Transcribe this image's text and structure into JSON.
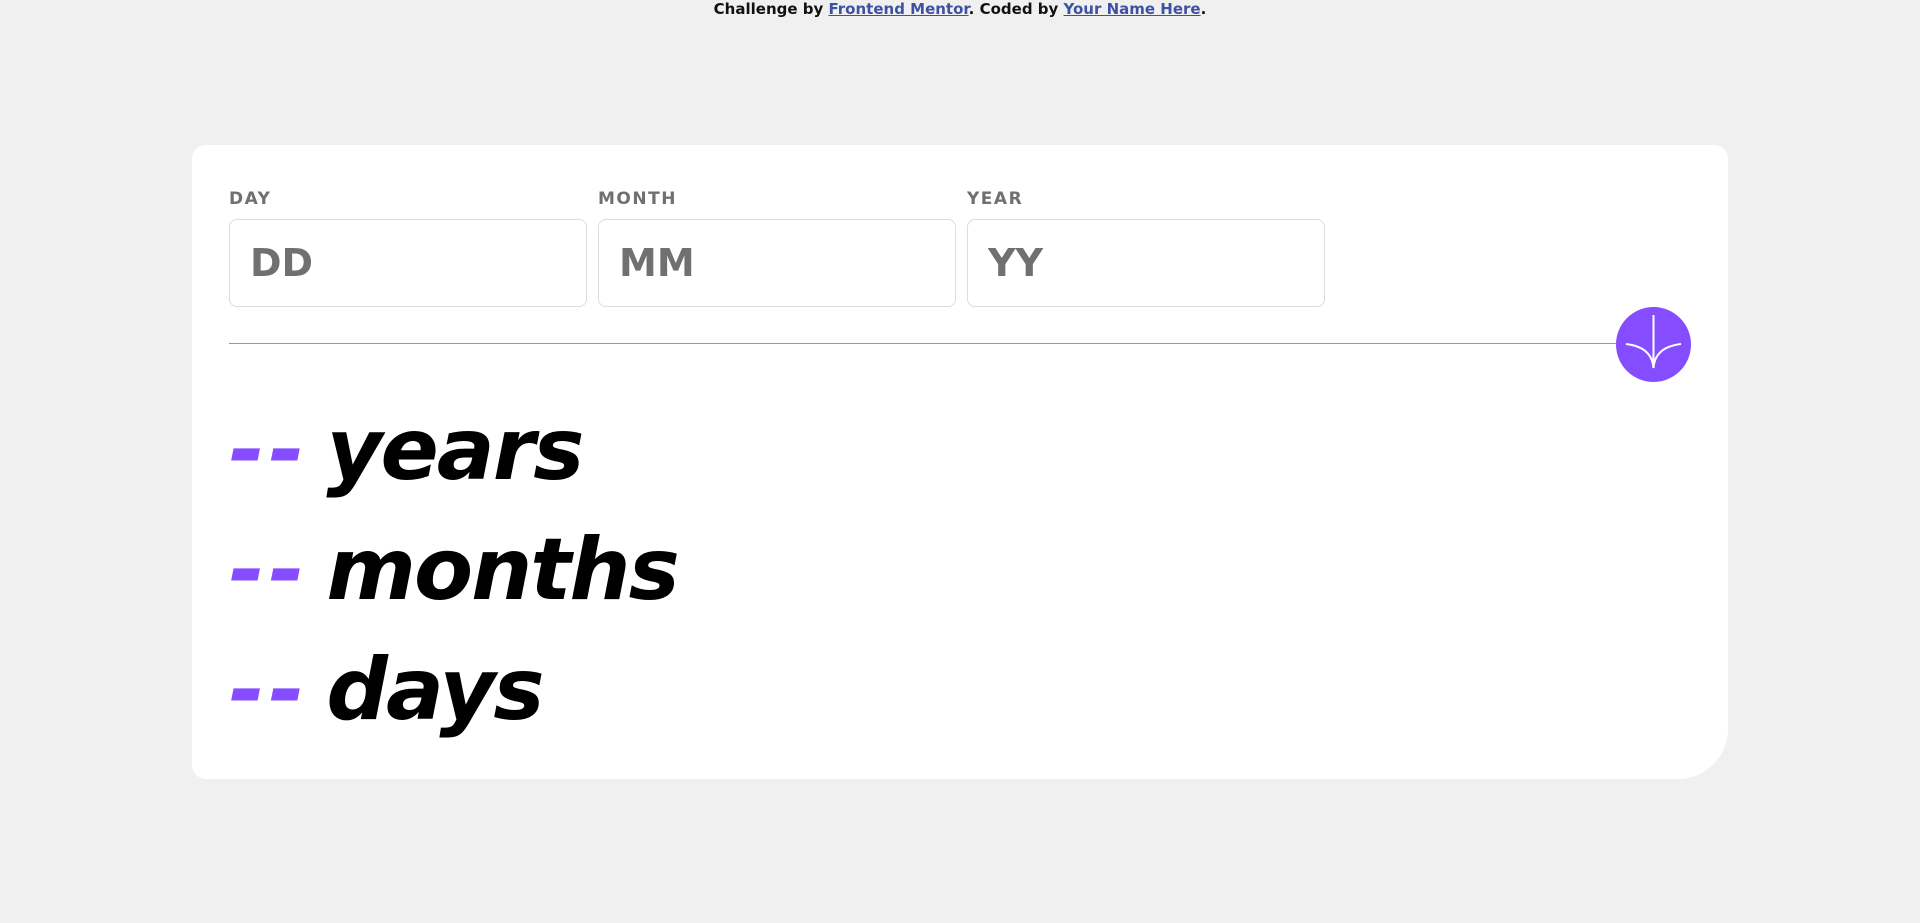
{
  "attribution": {
    "prefix": "Challenge by ",
    "link1": "Frontend Mentor",
    "middle": ". Coded by ",
    "link2": "Your Name Here",
    "suffix": "."
  },
  "form": {
    "day": {
      "label": "DAY",
      "placeholder": "DD",
      "value": ""
    },
    "month": {
      "label": "MONTH",
      "placeholder": "MM",
      "value": ""
    },
    "year": {
      "label": "YEAR",
      "placeholder": "YY",
      "value": ""
    }
  },
  "submit": {
    "icon": "arrow-down-icon",
    "color": "#854dff"
  },
  "results": [
    {
      "value": "--",
      "unit": "years"
    },
    {
      "value": "--",
      "unit": "months"
    },
    {
      "value": "--",
      "unit": "days"
    }
  ],
  "colors": {
    "accent": "#854dff",
    "background": "#f0f0f0",
    "card": "#ffffff",
    "label": "#716f6f",
    "link": "#3e52a3"
  }
}
